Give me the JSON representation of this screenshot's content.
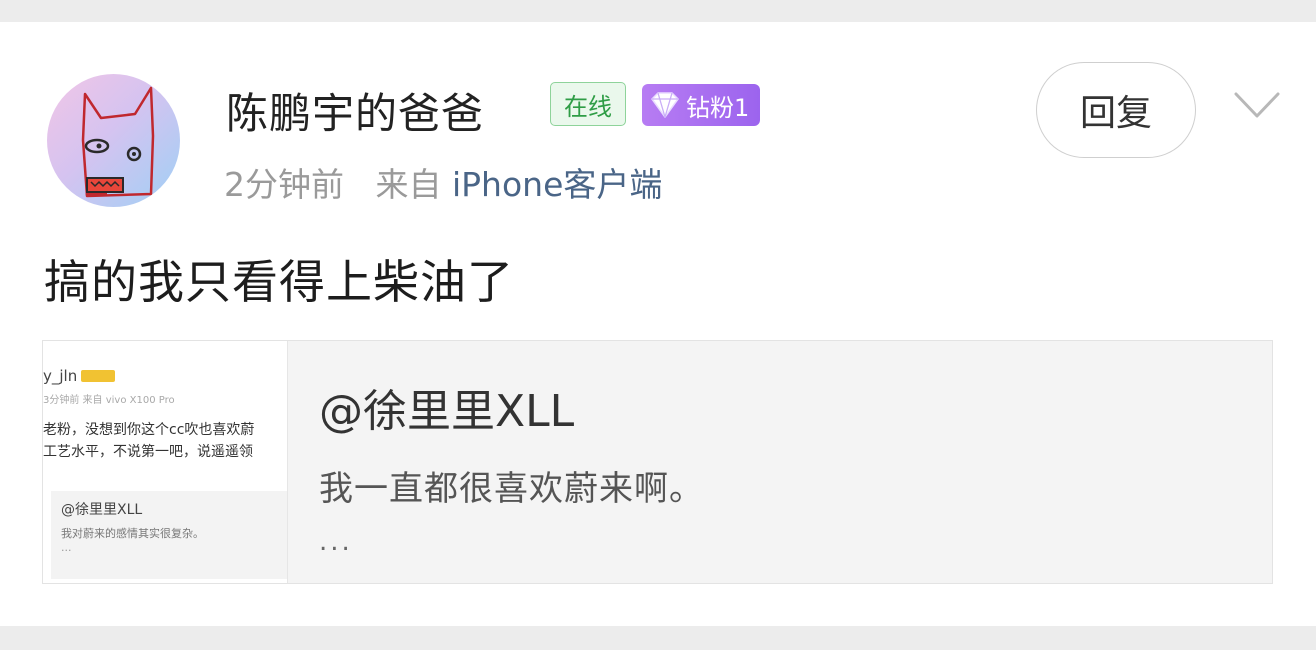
{
  "post": {
    "username": "陈鹏宇的爸爸",
    "badges": {
      "online": "在线",
      "fan": "钻粉1"
    },
    "time": "2分钟前",
    "source_prefix": "来自",
    "source": "iPhone客户端",
    "reply_label": "回复",
    "content": "搞的我只看得上柴油了"
  },
  "quote": {
    "user": "@徐里里XLL",
    "text": "我一直都很喜欢蔚来啊。",
    "more": "...",
    "thumbnail": {
      "username": "y_jln",
      "meta": "3分钟前  来自 vivo X100 Pro",
      "line1": "老粉，没想到你这个cc吹也喜欢蔚",
      "line2": "工艺水平，不说第一吧，说遥遥领",
      "quote_user": "@徐里里XLL",
      "quote_text": "我对蔚来的感情其实很复杂。",
      "quote_more": "..."
    }
  },
  "colors": {
    "background": "#ececec",
    "online_badge": "#2f9d46",
    "fan_badge": "#a56cf0",
    "source_link": "#4a6587"
  },
  "icons": {
    "gem": "diamond-icon",
    "chevron": "chevron-down-icon",
    "avatar": "hand-drawn-cat-face"
  }
}
